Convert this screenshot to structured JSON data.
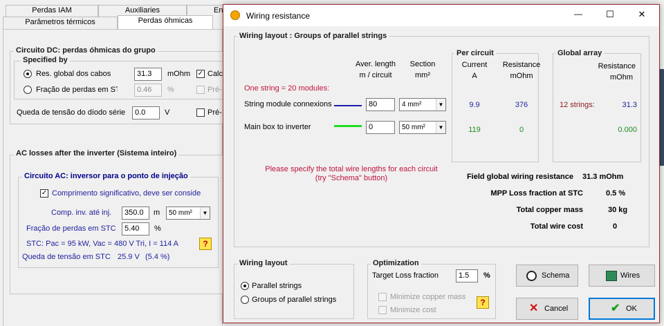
{
  "background": {
    "tabs_row1": [
      "Perdas IAM",
      "Auxiliaries",
      "En"
    ],
    "tabs_row2": [
      "Parâmetros térmicos",
      "Perdas óhmicas"
    ],
    "dc": {
      "title": "Circuito DC: perdas óhmicas do grupo",
      "specified_by": "Specified by",
      "opt1": "Res. global dos cabos",
      "opt1_value": "31.3",
      "opt1_unit": "mOhm",
      "opt2": "Fração de perdas em STC",
      "opt2_value": "0.46",
      "opt2_unit": "%",
      "chk1": "Calc",
      "chk2": "Pré-",
      "diode_label": "Queda de tensão do díodo série",
      "diode_value": "0.0",
      "diode_unit": "V",
      "chk3": "Pré-"
    },
    "ac": {
      "title": "AC losses after the inverter  (Sistema inteiro)",
      "subtitle": "Circuito AC: inversor para o ponto de injeção",
      "chk": "Comprimento significativo, deve ser considerado",
      "length_label": "Comp. inv. até inj.",
      "length_value": "350.0",
      "length_unit": "m",
      "section_value": "50 mm²",
      "loss_label": "Fração de perdas em STC",
      "loss_value": "5.40",
      "loss_unit": "%",
      "stc": "STC: Pac = 95 kW, Vac = 480 V Tri, I = 114 A",
      "drop_label": "Queda de tensão em STC",
      "drop_value": "25.9 V",
      "drop_pct": "(5.4 %)",
      "help": "?"
    }
  },
  "dialog": {
    "title": "Wiring resistance",
    "controls": {
      "minimize": "—",
      "maximize": "☐",
      "close": "✕"
    },
    "layout_title": "Wiring layout :  Groups of parallel strings",
    "col_length": "Aver. length",
    "col_length2": "m / circuit",
    "col_section": "Section",
    "col_section2": "mm²",
    "one_string": "One string = 20 modules:",
    "rows": [
      {
        "label": "String module connexions",
        "line_color": "#1a1aa8",
        "length": "80",
        "section": "4 mm²",
        "current": "9.9",
        "resistance": "376",
        "ga_label": "12 strings:",
        "ga_value": "31.3"
      },
      {
        "label": "Main box to inverter",
        "line_color": "#22dd22",
        "length": "0",
        "section": "50 mm²",
        "current": "119",
        "resistance": "0",
        "ga_label": "",
        "ga_value": "0.000"
      }
    ],
    "per_circuit": {
      "title": "Per circuit",
      "current": "Current",
      "current_unit": "A",
      "resistance": "Resistance",
      "resistance_unit": "mOhm"
    },
    "global_array": {
      "title": "Global array",
      "resistance": "Resistance",
      "resistance_unit": "mOhm"
    },
    "warning1": "Please specify the total wire lengths for each circuit",
    "warning2": "(try  \"Schema\" button)",
    "summary": [
      {
        "label": "Field global wiring resistance",
        "value": "31.3 mOhm"
      },
      {
        "label": "MPP Loss fraction at  STC",
        "value": "0.5 %"
      },
      {
        "label": "Total copper mass",
        "value": "30 kg"
      },
      {
        "label": "Total wire cost",
        "value": "0"
      }
    ],
    "wiring_layout": {
      "title": "Wiring layout",
      "opt1": "Parallel strings",
      "opt2": "Groups of parallel strings"
    },
    "optimization": {
      "title": "Optimization",
      "target_label": "Target Loss fraction",
      "target_value": "1.5",
      "target_unit": "%",
      "min_copper": "Minimize copper mass",
      "min_cost": "Minimize cost",
      "help": "?"
    },
    "buttons": {
      "schema": "Schema",
      "wires": "Wires",
      "cancel": "Cancel",
      "ok": "OK"
    }
  }
}
